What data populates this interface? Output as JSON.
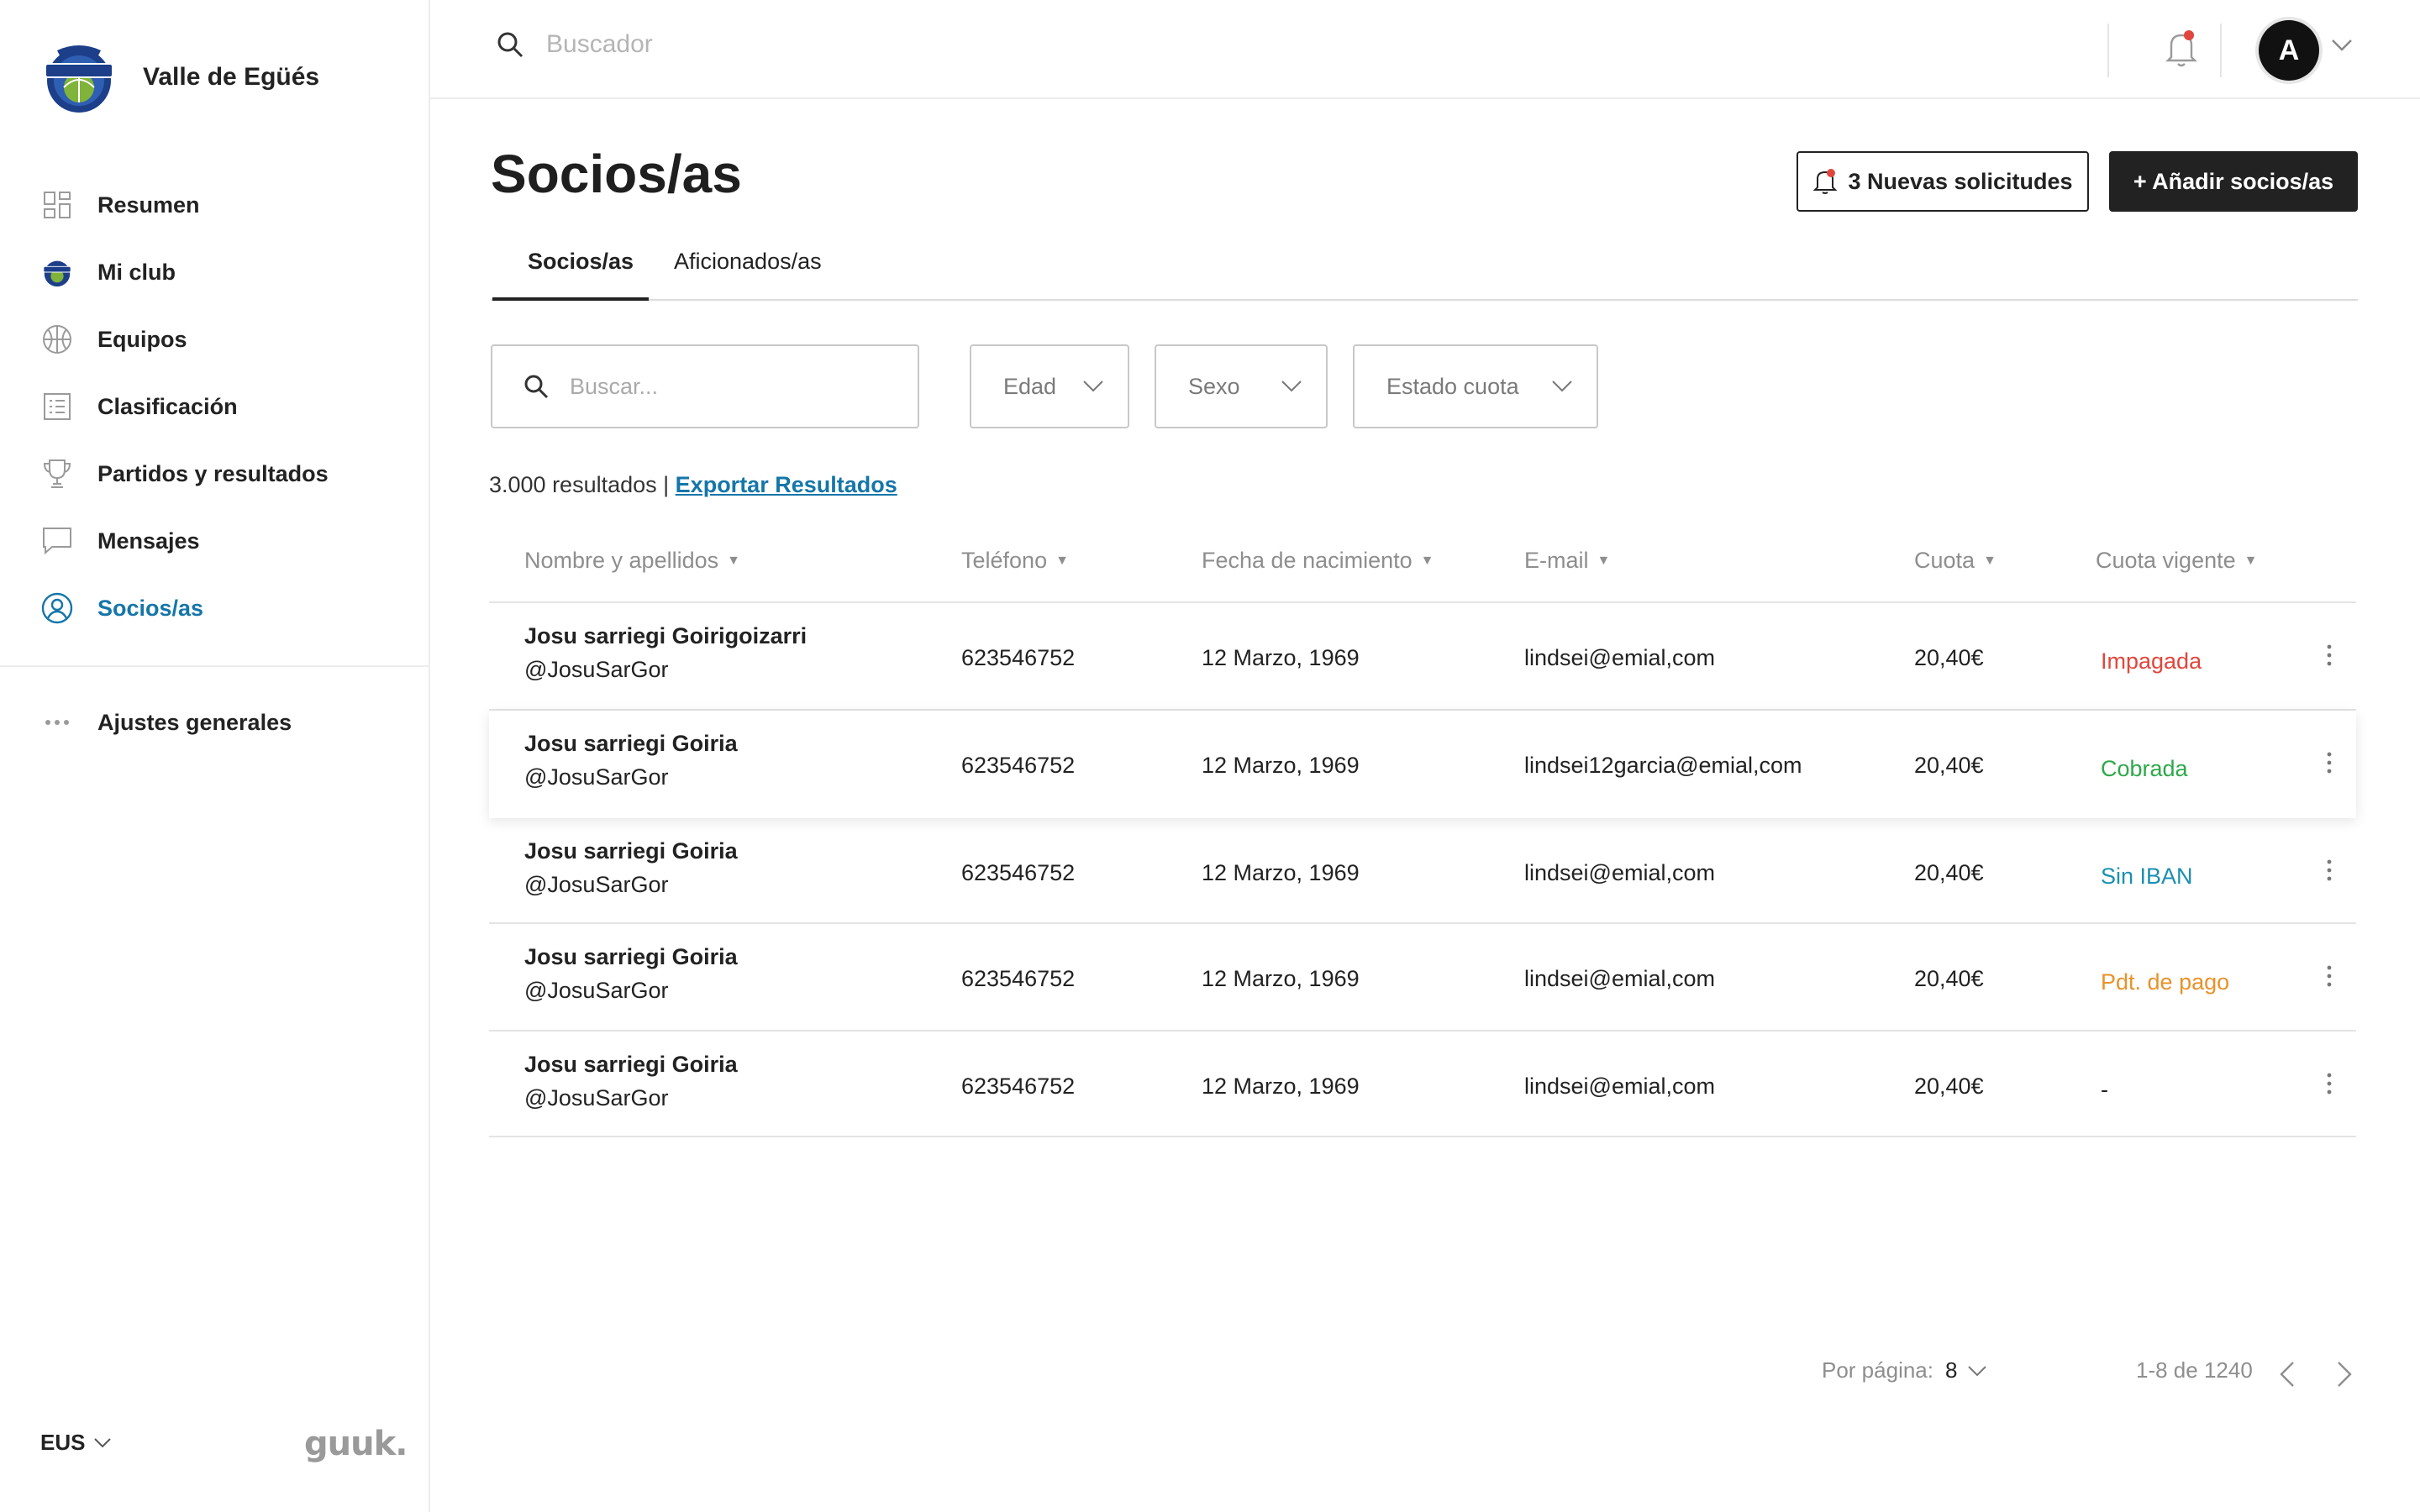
{
  "app": {
    "club_name": "Valle de Egüés",
    "logo_icon": "club-crest-icon",
    "brand": "guuk."
  },
  "sidebar": {
    "items": [
      {
        "label": "Resumen",
        "icon": "dashboard-icon",
        "active": false
      },
      {
        "label": "Mi club",
        "icon": "club-crest-icon",
        "active": false
      },
      {
        "label": "Equipos",
        "icon": "basketball-icon",
        "active": false
      },
      {
        "label": "Clasificación",
        "icon": "list-icon",
        "active": false
      },
      {
        "label": "Partidos y resultados",
        "icon": "trophy-icon",
        "active": false
      },
      {
        "label": "Mensajes",
        "icon": "chat-icon",
        "active": false
      },
      {
        "label": "Socios/as",
        "icon": "member-icon",
        "active": true
      }
    ],
    "settings_label": "Ajustes generales",
    "language": "EUS"
  },
  "topbar": {
    "search_placeholder": "Buscador",
    "avatar_initial": "A"
  },
  "page": {
    "title": "Socios/as",
    "requests_button": "3 Nuevas solicitudes",
    "add_button": "+ Añadir socios/as",
    "tabs": [
      {
        "label": "Socios/as",
        "active": true
      },
      {
        "label": "Aficionados/as",
        "active": false
      }
    ]
  },
  "filters": {
    "search_placeholder": "Buscar...",
    "age": "Edad",
    "sex": "Sexo",
    "fee_status": "Estado cuota"
  },
  "results": {
    "count_text": "3.000 resultados |",
    "export_label": "Exportar Resultados"
  },
  "table": {
    "columns": [
      "Nombre y apellidos",
      "Teléfono",
      "Fecha de nacimiento",
      "E-mail",
      "Cuota",
      "Cuota vigente"
    ],
    "rows": [
      {
        "name": "Josu sarriegi Goirigoizarri",
        "user": "@JosuSarGor",
        "phone": "623546752",
        "birth": "12 Marzo, 1969",
        "email": "lindsei@emial,com",
        "fee": "20,40€",
        "status": "Impagada",
        "status_color": "#e0463c"
      },
      {
        "name": "Josu sarriegi Goiria",
        "user": "@JosuSarGor",
        "phone": "623546752",
        "birth": "12 Marzo, 1969",
        "email": "lindsei12garcia@emial,com",
        "fee": "20,40€",
        "status": "Cobrada",
        "status_color": "#2ea84a"
      },
      {
        "name": "Josu sarriegi Goiria",
        "user": "@JosuSarGor",
        "phone": "623546752",
        "birth": "12 Marzo, 1969",
        "email": "lindsei@emial,com",
        "fee": "20,40€",
        "status": "Sin IBAN",
        "status_color": "#1a8fb0"
      },
      {
        "name": "Josu sarriegi Goiria",
        "user": "@JosuSarGor",
        "phone": "623546752",
        "birth": "12 Marzo, 1969",
        "email": "lindsei@emial,com",
        "fee": "20,40€",
        "status": "Pdt. de pago",
        "status_color": "#e8922a"
      },
      {
        "name": "Josu sarriegi Goiria",
        "user": "@JosuSarGor",
        "phone": "623546752",
        "birth": "12 Marzo, 1969",
        "email": "lindsei@emial,com",
        "fee": "20,40€",
        "status": "-",
        "status_color": "#222222"
      }
    ]
  },
  "pagination": {
    "per_page_label": "Por página:",
    "per_page_value": "8",
    "range": "1-8 de 1240"
  },
  "colors": {
    "accent": "#1576a8",
    "dark": "#222222",
    "notification": "#e0463c"
  }
}
